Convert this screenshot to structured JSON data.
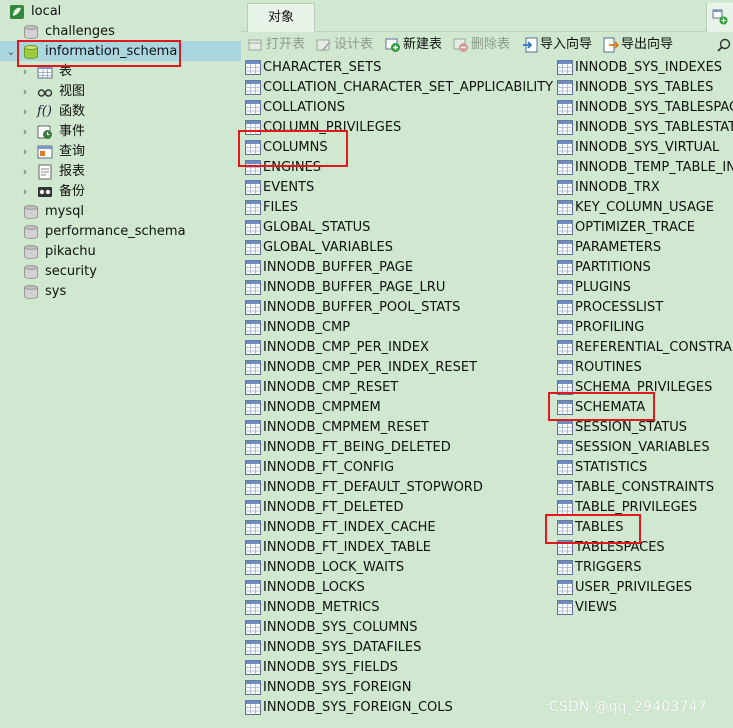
{
  "tree": {
    "connection": "local",
    "databases_before": [
      "challenges"
    ],
    "selected_database": "information_schema",
    "children": [
      {
        "label": "表",
        "icon": "table-icon"
      },
      {
        "label": "视图",
        "icon": "view-glasses-icon"
      },
      {
        "label": "函数",
        "icon": "function-icon"
      },
      {
        "label": "事件",
        "icon": "event-clock-icon"
      },
      {
        "label": "查询",
        "icon": "query-icon"
      },
      {
        "label": "报表",
        "icon": "report-icon"
      },
      {
        "label": "备份",
        "icon": "backup-icon"
      }
    ],
    "databases_after": [
      "mysql",
      "performance_schema",
      "pikachu",
      "security",
      "sys"
    ]
  },
  "tabs": {
    "objects": "对象"
  },
  "toolbar": {
    "open_table": "打开表",
    "design_table": "设计表",
    "new_table": "新建表",
    "delete_table": "删除表",
    "import_wizard": "导入向导",
    "export_wizard": "导出向导"
  },
  "objects": {
    "column1": [
      "CHARACTER_SETS",
      "COLLATION_CHARACTER_SET_APPLICABILITY",
      "COLLATIONS",
      "COLUMN_PRIVILEGES",
      "COLUMNS",
      "ENGINES",
      "EVENTS",
      "FILES",
      "GLOBAL_STATUS",
      "GLOBAL_VARIABLES",
      "INNODB_BUFFER_PAGE",
      "INNODB_BUFFER_PAGE_LRU",
      "INNODB_BUFFER_POOL_STATS",
      "INNODB_CMP",
      "INNODB_CMP_PER_INDEX",
      "INNODB_CMP_PER_INDEX_RESET",
      "INNODB_CMP_RESET",
      "INNODB_CMPMEM",
      "INNODB_CMPMEM_RESET",
      "INNODB_FT_BEING_DELETED",
      "INNODB_FT_CONFIG",
      "INNODB_FT_DEFAULT_STOPWORD",
      "INNODB_FT_DELETED",
      "INNODB_FT_INDEX_CACHE",
      "INNODB_FT_INDEX_TABLE",
      "INNODB_LOCK_WAITS",
      "INNODB_LOCKS",
      "INNODB_METRICS",
      "INNODB_SYS_COLUMNS",
      "INNODB_SYS_DATAFILES",
      "INNODB_SYS_FIELDS",
      "INNODB_SYS_FOREIGN",
      "INNODB_SYS_FOREIGN_COLS"
    ],
    "column2": [
      "INNODB_SYS_INDEXES",
      "INNODB_SYS_TABLES",
      "INNODB_SYS_TABLESPACES",
      "INNODB_SYS_TABLESTATS",
      "INNODB_SYS_VIRTUAL",
      "INNODB_TEMP_TABLE_INFO",
      "INNODB_TRX",
      "KEY_COLUMN_USAGE",
      "OPTIMIZER_TRACE",
      "PARAMETERS",
      "PARTITIONS",
      "PLUGINS",
      "PROCESSLIST",
      "PROFILING",
      "REFERENTIAL_CONSTRAINTS",
      "ROUTINES",
      "SCHEMA_PRIVILEGES",
      "SCHEMATA",
      "SESSION_STATUS",
      "SESSION_VARIABLES",
      "STATISTICS",
      "TABLE_CONSTRAINTS",
      "TABLE_PRIVILEGES",
      "TABLES",
      "TABLESPACES",
      "TRIGGERS",
      "USER_PRIVILEGES",
      "VIEWS"
    ]
  },
  "highlighted": [
    "information_schema",
    "COLUMNS",
    "SCHEMATA",
    "TABLES"
  ],
  "watermark": "CSDN @qq_29403747",
  "colors": {
    "background": "#cfe8cf",
    "selection": "#a9d6df",
    "highlight_box": "#e0191c"
  }
}
